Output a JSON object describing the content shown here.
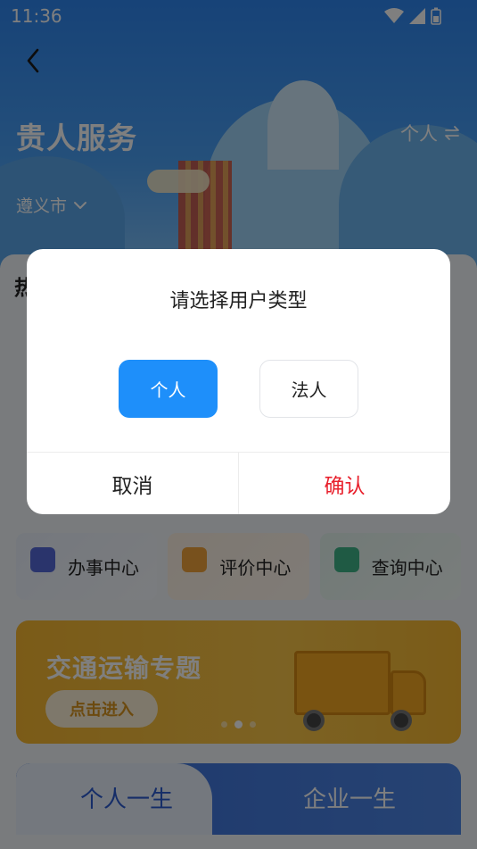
{
  "status_bar": {
    "time": "11:36"
  },
  "header": {
    "title": "贵人服务",
    "user_type": "个人",
    "city": "遵义市"
  },
  "hot_section": {
    "title": "热"
  },
  "centers": [
    {
      "label": "办事中心"
    },
    {
      "label": "评价中心"
    },
    {
      "label": "查询中心"
    }
  ],
  "banner": {
    "title": "交通运输专题",
    "button": "点击进入"
  },
  "life_tabs": [
    {
      "label": "个人一生"
    },
    {
      "label": "企业一生"
    }
  ],
  "dialog": {
    "title": "请选择用户类型",
    "options": [
      "个人",
      "法人"
    ],
    "cancel": "取消",
    "confirm": "确认"
  },
  "colors": {
    "primary": "#1e8ffa",
    "confirm": "#e8202c",
    "overlay": "rgba(0,0,0,0.5)"
  }
}
